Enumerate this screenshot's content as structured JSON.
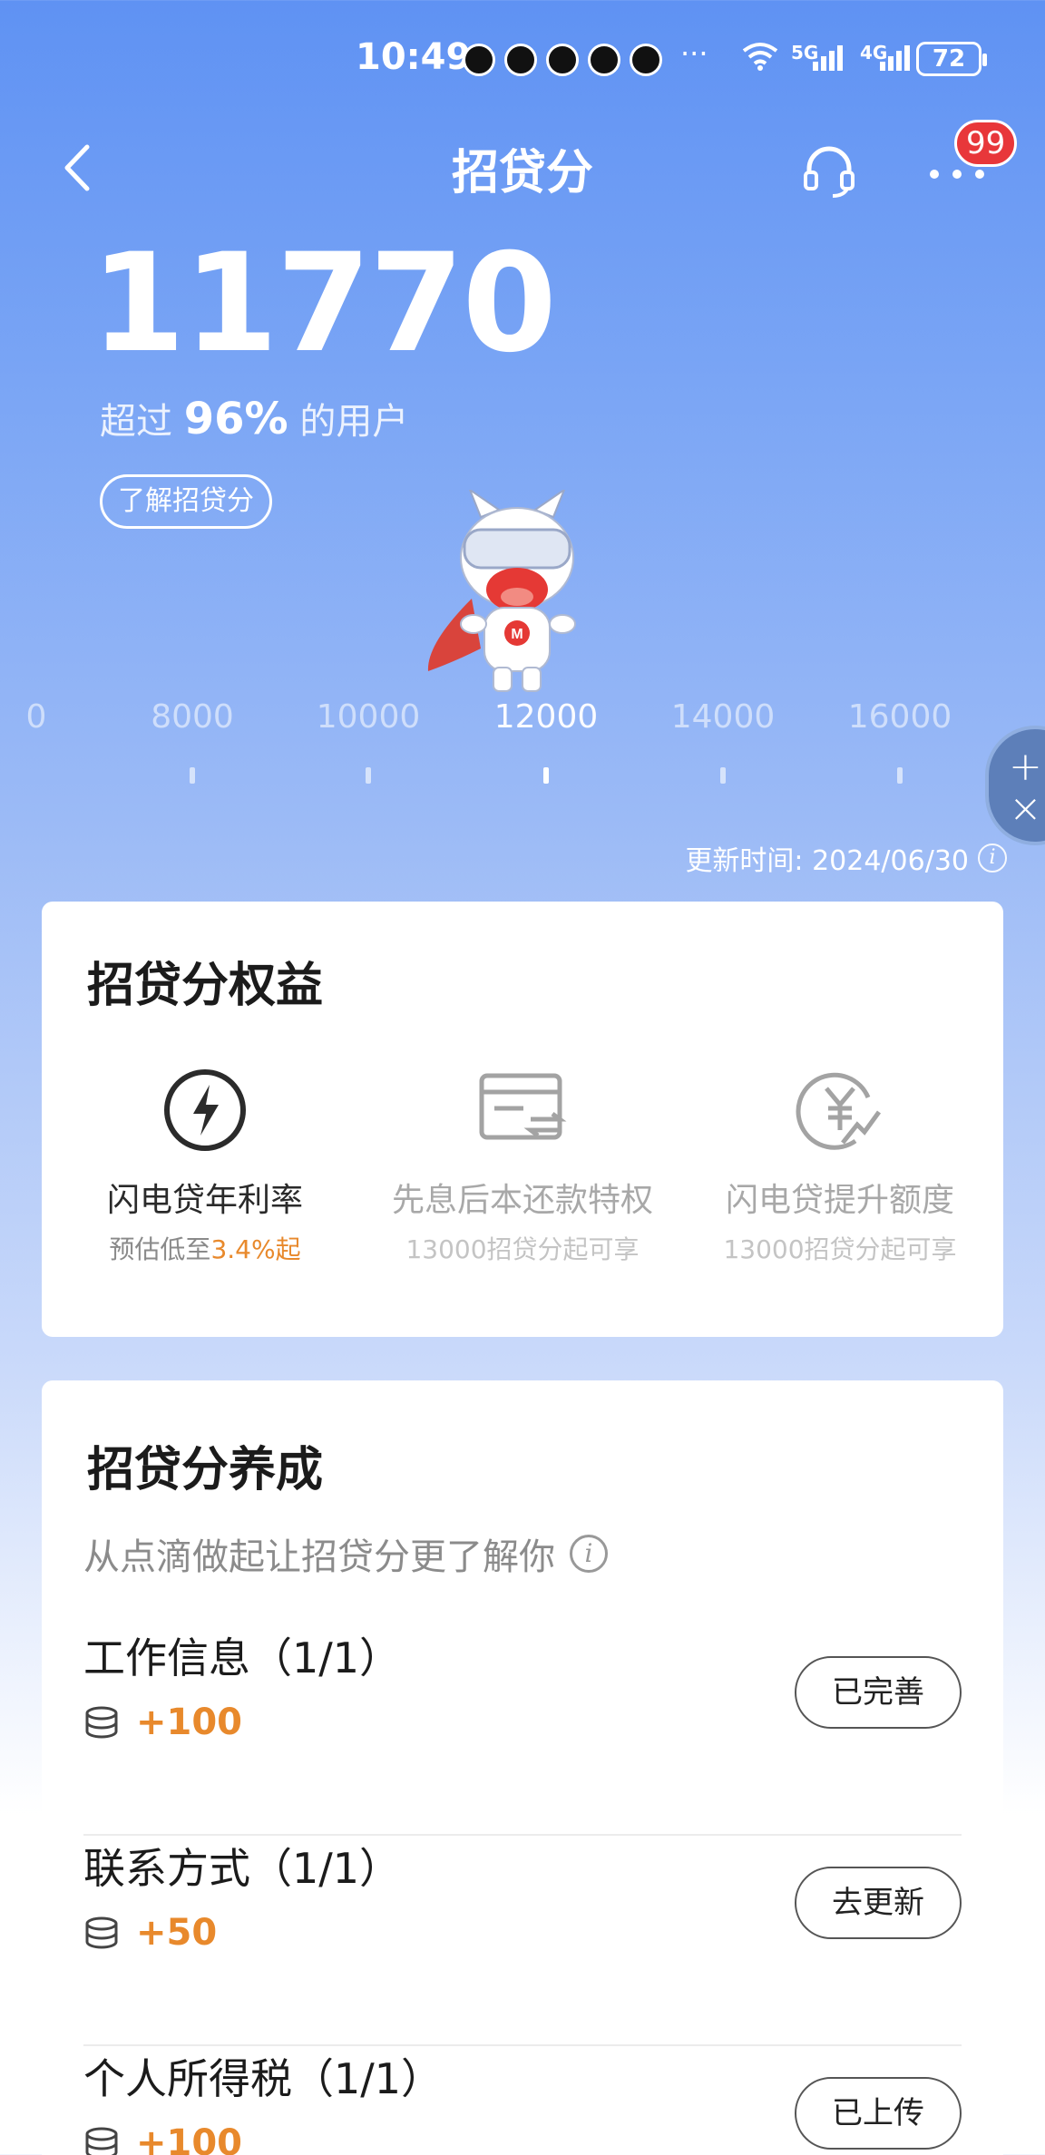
{
  "status_bar": {
    "time": "10:49",
    "more": "···",
    "net_5g": "5G",
    "net_4g": "4G",
    "battery": "72"
  },
  "nav": {
    "title": "招贷分",
    "badge": "99"
  },
  "score": {
    "value": "11770",
    "percent_prefix": "超过",
    "percent_value": "96%",
    "percent_suffix": "的用户",
    "learn_button": "了解招贷分"
  },
  "scale": {
    "ticks": [
      "0",
      "8000",
      "10000",
      "12000",
      "14000",
      "16000"
    ],
    "active_tick": "12000"
  },
  "update_time": "更新时间: 2024/06/30",
  "benefits": {
    "title": "招贷分权益",
    "items": [
      {
        "name": "闪电贷年利率",
        "sub_prefix": "预估低至",
        "sub_highlight": "3.4%起",
        "icon": "lightning-icon",
        "enabled": true
      },
      {
        "name": "先息后本还款特权",
        "sub": "13000招贷分起可享",
        "icon": "card-transfer-icon",
        "enabled": false
      },
      {
        "name": "闪电贷提升额度",
        "sub": "13000招贷分起可享",
        "icon": "yen-up-icon",
        "enabled": false
      }
    ]
  },
  "cultivate": {
    "title": "招贷分养成",
    "subtitle": "从点滴做起让招贷分更了解你",
    "tasks": [
      {
        "name": "工作信息（1/1）",
        "points": "+100",
        "button": "已完善"
      },
      {
        "name": "联系方式（1/1）",
        "points": "+50",
        "button": "去更新"
      },
      {
        "name": "个人所得税（1/1）",
        "points": "+100",
        "button": "已上传"
      }
    ]
  },
  "colors": {
    "accent_orange": "#e8892c",
    "badge_red": "#e8373a",
    "header_blue": "#5f92f3"
  }
}
